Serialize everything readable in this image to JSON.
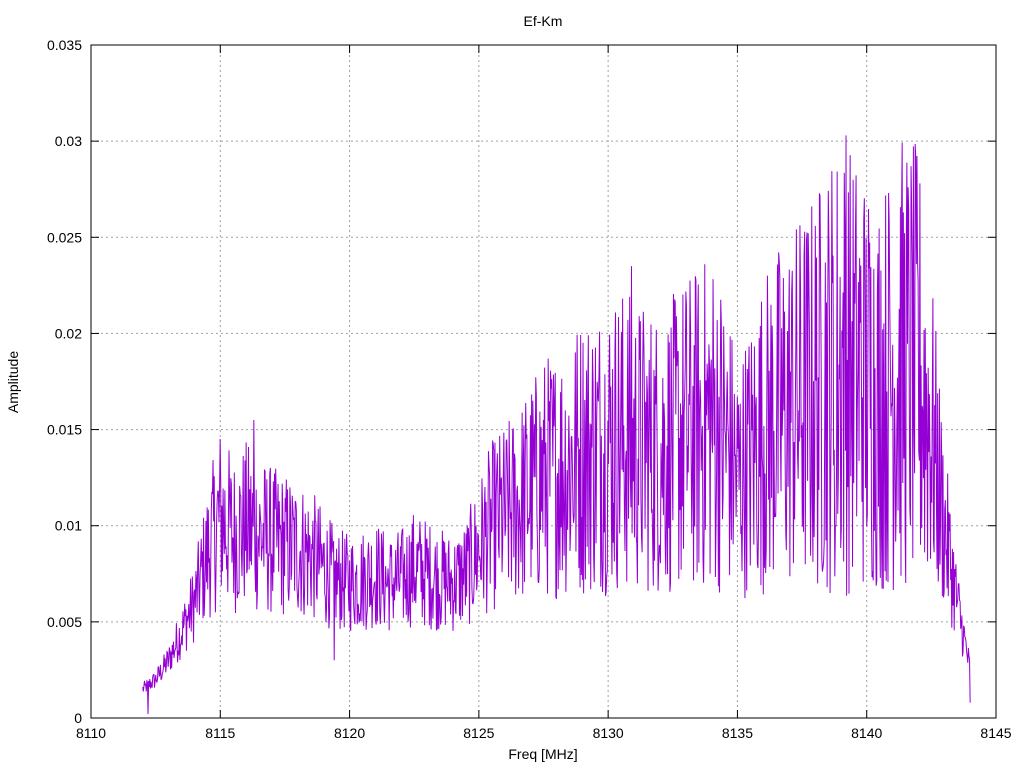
{
  "chart_data": {
    "type": "line",
    "title": "Ef-Km",
    "xlabel": "Freq [MHz]",
    "ylabel": "Amplitude",
    "xlim": [
      8110,
      8145
    ],
    "ylim": [
      0,
      0.035
    ],
    "grid": true,
    "x_ticks": [
      "8110",
      "8115",
      "8120",
      "8125",
      "8130",
      "8135",
      "8140",
      "8145"
    ],
    "y_ticks": [
      "0",
      "0.005",
      "0.01",
      "0.015",
      "0.02",
      "0.025",
      "0.03",
      "0.035"
    ],
    "series": [
      {
        "color": "#9400d3",
        "x": [
          8112.0,
          8112.5,
          8113.0,
          8113.5,
          8114.0,
          8114.5,
          8115.0,
          8115.5,
          8116.0,
          8116.5,
          8117.0,
          8117.5,
          8118.0,
          8118.5,
          8119.0,
          8119.5,
          8120.0,
          8120.5,
          8121.0,
          8121.5,
          8122.0,
          8122.5,
          8123.0,
          8123.5,
          8124.0,
          8124.5,
          8125.0,
          8125.5,
          8126.0,
          8126.5,
          8127.0,
          8127.5,
          8128.0,
          8128.5,
          8129.0,
          8129.5,
          8130.0,
          8130.5,
          8131.0,
          8131.5,
          8132.0,
          8132.5,
          8133.0,
          8133.5,
          8134.0,
          8134.5,
          8135.0,
          8135.5,
          8136.0,
          8136.5,
          8137.0,
          8137.5,
          8138.0,
          8138.5,
          8139.0,
          8139.5,
          8140.0,
          8140.5,
          8141.0,
          8141.5,
          8142.0,
          8142.5,
          8143.0,
          8143.5,
          8144.0
        ],
        "y": [
          0.0015,
          0.002,
          0.003,
          0.0045,
          0.006,
          0.0085,
          0.0105,
          0.0095,
          0.01,
          0.0095,
          0.0092,
          0.009,
          0.0088,
          0.0085,
          0.0078,
          0.0072,
          0.007,
          0.0072,
          0.0075,
          0.007,
          0.0072,
          0.0078,
          0.0075,
          0.0072,
          0.007,
          0.0075,
          0.0088,
          0.01,
          0.0105,
          0.011,
          0.0118,
          0.0125,
          0.0128,
          0.0132,
          0.0138,
          0.014,
          0.0143,
          0.0145,
          0.0142,
          0.014,
          0.0138,
          0.0142,
          0.0148,
          0.015,
          0.0155,
          0.0145,
          0.0125,
          0.0135,
          0.0148,
          0.0155,
          0.016,
          0.0165,
          0.017,
          0.0178,
          0.0185,
          0.018,
          0.0175,
          0.017,
          0.0178,
          0.0185,
          0.018,
          0.015,
          0.01,
          0.006,
          0.0025
        ],
        "peaks": [
          {
            "x": 8116.3,
            "y": 0.0155
          },
          {
            "x": 8130.9,
            "y": 0.0235
          },
          {
            "x": 8139.2,
            "y": 0.0303
          },
          {
            "x": 8141.6,
            "y": 0.0276
          }
        ],
        "troughs": [
          {
            "x": 8112.2,
            "y": 0.0002
          },
          {
            "x": 8119.4,
            "y": 0.003
          },
          {
            "x": 8138.8,
            "y": 0.01
          },
          {
            "x": 8140.5,
            "y": 0.01
          },
          {
            "x": 8144.0,
            "y": 0.0008
          }
        ]
      }
    ]
  }
}
